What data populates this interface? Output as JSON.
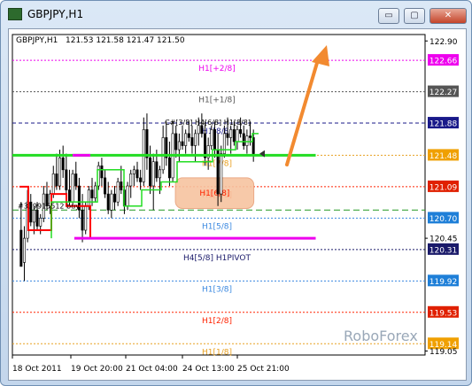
{
  "window": {
    "title": "GBPJPY,H1",
    "controls": {
      "minimize": "▭",
      "maximize": "▢",
      "close": "✕"
    }
  },
  "chart_data": {
    "type": "candlestick",
    "symbol_label": "GBPJPY,H1",
    "ohlc_label": "121.53 121.58 121.47 121.50",
    "ylim": [
      119.0,
      122.98
    ],
    "y_ticks": [
      "122.90",
      "122.66",
      "122.27",
      "121.88",
      "121.48",
      "121.09",
      "120.70",
      "120.45",
      "120.31",
      "119.92",
      "119.53",
      "119.14",
      "119.05"
    ],
    "x_ticks": [
      "18 Oct 2011",
      "19 Oct 20:00",
      "21 Oct 04:00",
      "24 Oct 13:00",
      "25 Oct 21:00"
    ],
    "levels": [
      {
        "label": "H1[+2/8]",
        "value": 122.66,
        "color": "#ee00ee",
        "style": "dotted",
        "box": "#ee00ee"
      },
      {
        "label": "H1[+1/8]",
        "value": 122.27,
        "color": "#555555",
        "style": "dotted",
        "box": "#555555"
      },
      {
        "label": "H1[8/8]",
        "value": 121.88,
        "color": "#1a1a8a",
        "style": "dashed",
        "box": "#1a1a8a"
      },
      {
        "label": "H1[7/8]",
        "value": 121.48,
        "color": "#e8a020",
        "style": "dotted",
        "box": "#f0a000"
      },
      {
        "label": "H1[6/8]",
        "value": 121.09,
        "color": "#ff2200",
        "style": "dotted",
        "box": "#e02000"
      },
      {
        "label": "H1[5/8]",
        "value": 120.7,
        "color": "#3a88e0",
        "style": "dotted",
        "box": "#1e7fd8"
      },
      {
        "label": "H4[5/8] H1PIVOT",
        "value": 120.31,
        "color": "#1a1a6a",
        "style": "dotted",
        "box": "#1a1a6a"
      },
      {
        "label": "H1[3/8]",
        "value": 119.92,
        "color": "#3a88e0",
        "style": "dotted",
        "box": "#1e7fd8"
      },
      {
        "label": "H1[2/8]",
        "value": 119.53,
        "color": "#ff2200",
        "style": "dotted",
        "box": "#e02000"
      },
      {
        "label": "H1[1/8]",
        "value": 119.14,
        "color": "#e8a020",
        "style": "dotted",
        "box": "#f0a000"
      }
    ],
    "level_text_color_overrides": {
      "H1[+2/8]": "#ee00ee",
      "H1[+1/8]": "#555555"
    },
    "h4_lines": [
      {
        "value": 121.48,
        "color": "#22dd22",
        "x_from": 0,
        "x_to": 0.735
      },
      {
        "value": 120.45,
        "color": "#ee00ee",
        "x_from": 0.15,
        "x_to": 0.735
      }
    ],
    "green_dash_level": {
      "value": 120.8,
      "color": "#229922"
    },
    "order_label": "#339915512 buy",
    "order_level": 120.8,
    "annotation_text": "C#[3/8] H4[6/8] H1[8/8]",
    "close_price": 121.5,
    "highlight": {
      "label": "H1[6/8]",
      "price_low": 120.82,
      "price_high": 121.2,
      "color": "#f7c4a0"
    },
    "arrow": {
      "color": "#f28a30",
      "direction": "up-right"
    },
    "watermark": "RoboForex",
    "candles": [
      [
        120.55,
        120.9,
        120.3,
        120.1
      ],
      [
        120.15,
        120.6,
        119.92,
        120.45
      ],
      [
        120.45,
        121.05,
        120.4,
        120.9
      ],
      [
        120.9,
        121.0,
        120.6,
        120.65
      ],
      [
        120.65,
        120.85,
        120.5,
        120.8
      ],
      [
        120.8,
        120.9,
        120.55,
        120.6
      ],
      [
        120.6,
        120.75,
        120.5,
        120.7
      ],
      [
        120.7,
        121.1,
        120.65,
        121.0
      ],
      [
        121.0,
        121.15,
        120.8,
        120.85
      ],
      [
        120.85,
        121.05,
        120.75,
        121.0
      ],
      [
        121.0,
        121.35,
        120.95,
        121.25
      ],
      [
        121.25,
        121.5,
        121.05,
        121.1
      ],
      [
        121.1,
        121.55,
        121.05,
        121.45
      ],
      [
        121.45,
        121.6,
        121.2,
        121.3
      ],
      [
        121.3,
        121.5,
        121.0,
        121.05
      ],
      [
        121.05,
        121.3,
        120.85,
        120.9
      ],
      [
        120.9,
        121.3,
        120.85,
        121.25
      ],
      [
        121.25,
        121.4,
        121.05,
        121.1
      ],
      [
        121.1,
        121.2,
        120.7,
        120.8
      ],
      [
        120.8,
        121.0,
        120.4,
        120.55
      ],
      [
        120.55,
        120.9,
        120.5,
        120.85
      ],
      [
        120.85,
        121.1,
        120.8,
        121.05
      ],
      [
        121.05,
        121.2,
        120.85,
        120.95
      ],
      [
        120.95,
        121.15,
        120.9,
        121.1
      ],
      [
        121.1,
        121.4,
        121.05,
        121.35
      ],
      [
        121.35,
        121.45,
        121.1,
        121.2
      ],
      [
        121.2,
        121.3,
        120.95,
        121.0
      ],
      [
        121.0,
        121.15,
        120.75,
        120.8
      ],
      [
        120.8,
        121.05,
        120.7,
        121.0
      ],
      [
        121.0,
        121.1,
        120.8,
        120.9
      ],
      [
        120.9,
        121.2,
        120.85,
        121.15
      ],
      [
        121.15,
        121.35,
        121.0,
        121.05
      ],
      [
        121.05,
        121.1,
        120.75,
        120.85
      ],
      [
        120.85,
        121.15,
        120.8,
        121.1
      ],
      [
        121.1,
        121.3,
        120.95,
        121.25
      ],
      [
        121.25,
        121.35,
        121.1,
        121.3
      ],
      [
        121.3,
        121.4,
        121.15,
        121.2
      ],
      [
        121.2,
        121.3,
        121.05,
        121.15
      ],
      [
        121.15,
        121.95,
        121.1,
        121.8
      ],
      [
        121.8,
        122.0,
        121.3,
        121.45
      ],
      [
        121.45,
        121.6,
        121.0,
        121.1
      ],
      [
        121.1,
        121.5,
        120.8,
        121.4
      ],
      [
        121.4,
        121.55,
        121.15,
        121.2
      ],
      [
        121.2,
        121.35,
        121.0,
        121.3
      ],
      [
        121.3,
        121.85,
        121.25,
        121.7
      ],
      [
        121.7,
        121.9,
        121.35,
        121.45
      ],
      [
        121.45,
        121.65,
        121.1,
        121.2
      ],
      [
        121.2,
        121.9,
        121.15,
        121.75
      ],
      [
        121.75,
        121.85,
        121.45,
        121.55
      ],
      [
        121.55,
        121.75,
        121.4,
        121.65
      ],
      [
        121.65,
        121.85,
        121.55,
        121.6
      ],
      [
        121.6,
        121.8,
        121.5,
        121.75
      ],
      [
        121.75,
        121.9,
        121.65,
        121.7
      ],
      [
        121.7,
        121.85,
        121.5,
        121.6
      ],
      [
        121.6,
        121.8,
        121.4,
        121.75
      ],
      [
        121.75,
        121.95,
        121.6,
        121.85
      ],
      [
        121.85,
        122.0,
        121.7,
        121.75
      ],
      [
        121.75,
        121.9,
        121.35,
        121.45
      ],
      [
        121.45,
        121.7,
        121.3,
        121.6
      ],
      [
        121.6,
        121.85,
        121.55,
        121.8
      ],
      [
        121.8,
        121.9,
        121.45,
        121.55
      ],
      [
        121.55,
        121.75,
        120.85,
        121.0
      ],
      [
        121.0,
        121.6,
        120.9,
        121.5
      ],
      [
        121.5,
        121.85,
        121.45,
        121.75
      ],
      [
        121.75,
        121.95,
        121.6,
        121.7
      ],
      [
        121.7,
        121.85,
        121.5,
        121.8
      ],
      [
        121.8,
        121.9,
        121.6,
        121.65
      ],
      [
        121.65,
        121.85,
        121.55,
        121.8
      ],
      [
        121.8,
        121.95,
        121.7,
        121.75
      ],
      [
        121.75,
        121.85,
        121.55,
        121.6
      ],
      [
        121.6,
        121.8,
        121.5,
        121.72
      ],
      [
        121.72,
        121.9,
        121.6,
        121.7
      ],
      [
        121.7,
        121.8,
        121.4,
        121.5
      ]
    ]
  }
}
